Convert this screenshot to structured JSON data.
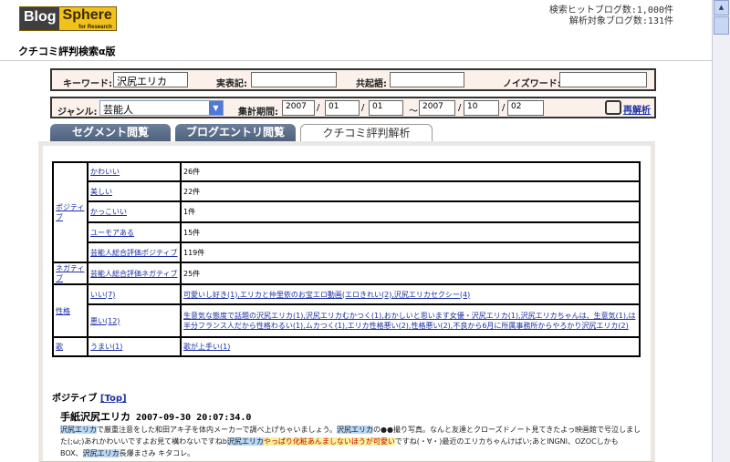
{
  "header": {
    "logo_left": "Blog",
    "logo_right": "Sphere",
    "logo_sub": "for Research",
    "stat1": "検索ヒットブログ数:1,000件",
    "stat2": "解析対象ブログ数:131件",
    "subtitle": "クチコミ評判検索α版"
  },
  "search": {
    "keyword_label": "キーワード:",
    "keyword_value": "沢尻エリカ",
    "exp_label": "実表記:",
    "exp_value": "",
    "co_label": "共起語:",
    "co_value": "",
    "noise_label": "ノイズワード:",
    "noise_value": "",
    "genre_label": "ジャンル:",
    "genre_value": "芸能人",
    "period_label": "集計期間:",
    "from_y": "2007",
    "from_m": "01",
    "from_d": "01",
    "tilde": "～",
    "to_y": "2007",
    "to_m": "10",
    "to_d": "02",
    "slash": "/",
    "reanalyze": "再解析"
  },
  "tabs": [
    {
      "label": "セグメント閲覧"
    },
    {
      "label": "ブログエントリ閲覧"
    },
    {
      "label": "クチコミ評判解析"
    }
  ],
  "table": {
    "positive": "ポジティブ",
    "negative": "ネガティブ",
    "personality": "性格",
    "song": "歌",
    "rows": {
      "kawaii": {
        "label": "かわいい",
        "count": "26件"
      },
      "utsukushii": {
        "label": "美しい",
        "count": "22件"
      },
      "kakkoii": {
        "label": "かっこいい",
        "count": "1件"
      },
      "humor": {
        "label": "ユーモアある",
        "count": "15件"
      },
      "pos_total": {
        "label": "芸能人総合評価ポジティブ",
        "count": "119件"
      },
      "neg_total": {
        "label": "芸能人総合評価ネガティブ",
        "count": "25件"
      },
      "ii": {
        "label": "いい(7)",
        "detail": "可愛いし好き(1),エリカと仲里依のお宝エロ動画(エロきれい(2),沢尻エリカセクシー(4)"
      },
      "warui": {
        "label": "悪い(12)",
        "detail": "生意気な態度で話題の沢尻エリカ(1),沢尻エリカむかつく(1),おかしいと思います女優・沢尻エリカ(1),沢尻エリカちゃんは、生意気(1),は半分フランス人だから性格わるい(1),ムカつく(1),エリカ性格悪い(2),性格悪い(2),不良から6月に所属事務所からやろかり沢尻エリカ(2)"
      },
      "umai": {
        "label": "うまい(1)",
        "detail": "歌が上手い(1)"
      }
    }
  },
  "entry": {
    "section": "ポジティブ",
    "top_link": "[Top]",
    "title": "手紙沢尻エリカ",
    "date": "2007-09-30 20:07:34.0",
    "hl_name": "沢尻エリカ",
    "body1": "で厳重注意をした和田アキ子を体内メーカーで調べ上げちゃいましょう。",
    "body2": "の●●撮り写真。なんと友達とクローズドノート見てきたよっ映画館で号泣しました(;ω;)あれかわいいですよお見て構わないですねb",
    "body3": "やっぱり化粧あんましないほうが可愛い",
    "body4": "ですね(・∀・)最近のエリカちゃんけばい;あとINGNI、OZOCしかもBOX、",
    "body5": "長爆まさみ キタコレ。"
  }
}
